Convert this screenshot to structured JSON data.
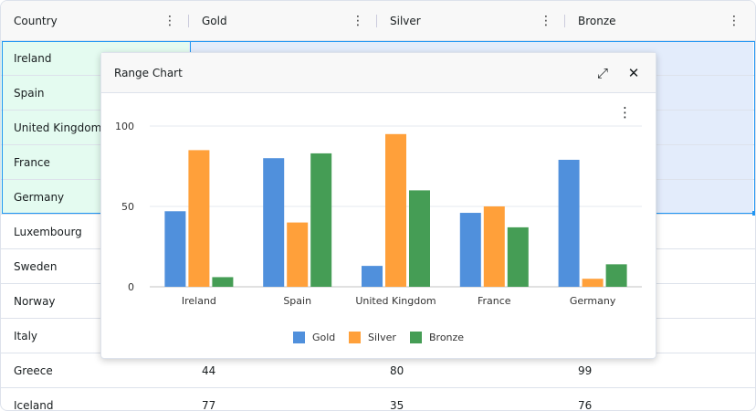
{
  "grid": {
    "columns": [
      "Country",
      "Gold",
      "Silver",
      "Bronze"
    ],
    "rows": [
      [
        "Ireland",
        "",
        "",
        ""
      ],
      [
        "Spain",
        "",
        "",
        ""
      ],
      [
        "United Kingdom",
        "",
        "",
        ""
      ],
      [
        "France",
        "",
        "",
        ""
      ],
      [
        "Germany",
        "",
        "",
        ""
      ],
      [
        "Luxembourg",
        "",
        "",
        ""
      ],
      [
        "Sweden",
        "",
        "",
        ""
      ],
      [
        "Norway",
        "",
        "",
        ""
      ],
      [
        "Italy",
        "",
        "",
        ""
      ],
      [
        "Greece",
        "44",
        "80",
        "99"
      ],
      [
        "Iceland",
        "77",
        "35",
        "76"
      ]
    ]
  },
  "dialog": {
    "title": "Range Chart",
    "expand_icon": "expand-icon",
    "close_icon": "close-icon"
  },
  "colors": {
    "Gold": "#5090dc",
    "Silver": "#ffa03a",
    "Bronze": "#459d55"
  },
  "chart_data": {
    "type": "bar",
    "categories": [
      "Ireland",
      "Spain",
      "United Kingdom",
      "France",
      "Germany"
    ],
    "series": [
      {
        "name": "Gold",
        "values": [
          47,
          80,
          13,
          46,
          79
        ]
      },
      {
        "name": "Silver",
        "values": [
          85,
          40,
          95,
          50,
          5
        ]
      },
      {
        "name": "Bronze",
        "values": [
          6,
          83,
          60,
          37,
          14
        ]
      }
    ],
    "yticks": [
      "0",
      "50",
      "100"
    ],
    "ylim": [
      0,
      100
    ],
    "legend": "bottom"
  }
}
